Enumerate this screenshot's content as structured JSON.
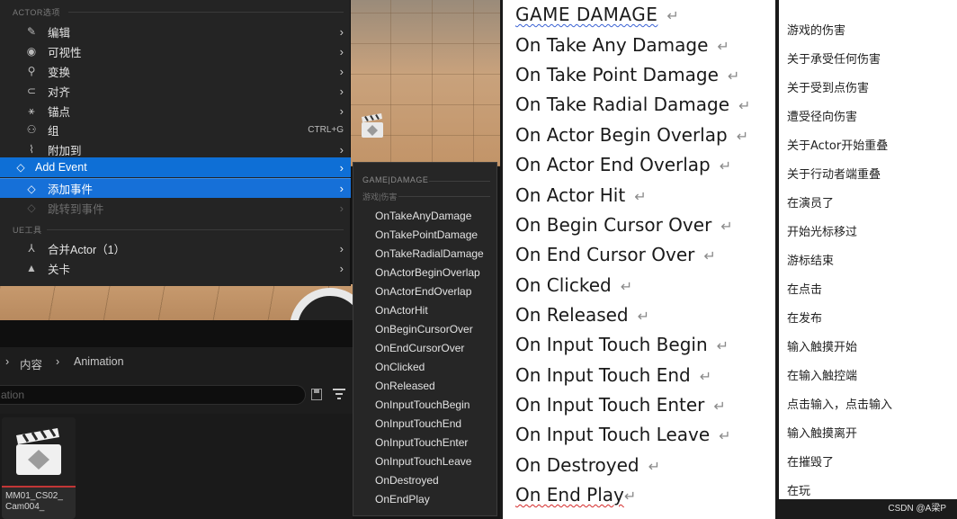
{
  "ue": {
    "actor_section_header": "ACTOR选项",
    "menu_items": [
      {
        "label": "编辑",
        "icon": "pencil-icon",
        "has_submenu": true
      },
      {
        "label": "可视性",
        "icon": "eye-icon",
        "has_submenu": true
      },
      {
        "label": "变换",
        "icon": "transform-icon",
        "has_submenu": true
      },
      {
        "label": "对齐",
        "icon": "magnet-icon",
        "has_submenu": true
      },
      {
        "label": "锚点",
        "icon": "pivot-icon",
        "has_submenu": true
      },
      {
        "label": "组",
        "icon": "group-icon",
        "shortcut": "CTRL+G"
      },
      {
        "label": "附加到",
        "icon": "attach-icon",
        "has_submenu": true
      },
      {
        "label": "Add Event",
        "icon": "event-icon",
        "has_submenu": true,
        "state": "highlighted"
      },
      {
        "label": "添加事件",
        "icon": "event-icon",
        "has_submenu": true,
        "state": "highlighted"
      },
      {
        "label": "跳转到事件",
        "icon": "jump-icon",
        "has_submenu": true,
        "state": "disabled"
      }
    ],
    "ue_tools_header": "UE工具",
    "tools_items": [
      {
        "label": "合并Actor（1）",
        "icon": "merge-icon",
        "has_submenu": true
      },
      {
        "label": "关卡",
        "icon": "level-icon",
        "has_submenu": true
      }
    ],
    "submenu": {
      "header": "GAME|DAMAGE",
      "subheader": "游戏|伤害",
      "items": [
        "OnTakeAnyDamage",
        "OnTakePointDamage",
        "OnTakeRadialDamage",
        "OnActorBeginOverlap",
        "OnActorEndOverlap",
        "OnActorHit",
        "OnBeginCursorOver",
        "OnEndCursorOver",
        "OnClicked",
        "OnReleased",
        "OnInputTouchBegin",
        "OnInputTouchEnd",
        "OnInputTouchEnter",
        "OnInputTouchLeave",
        "OnDestroyed",
        "OnEndPlay"
      ]
    },
    "breadcrumb": {
      "part1": "内容",
      "part2": "Animation"
    },
    "search_text": "ation",
    "asset_name": "MM01_CS02_\nCam004_",
    "accent_color": "#0e6fd6"
  },
  "en_list": {
    "title": "GAME   DAMAGE",
    "items": [
      "On Take Any Damage",
      "On Take Point Damage",
      "On Take Radial Damage",
      "On Actor Begin Overlap",
      "On Actor End Overlap",
      "On Actor Hit",
      "On Begin Cursor Over",
      "On End Cursor Over",
      "On Clicked",
      "On Released",
      "On Input Touch Begin",
      "On Input Touch End",
      "On Input Touch Enter",
      "On Input Touch Leave",
      "On Destroyed",
      "On End Play"
    ],
    "return_glyph": "↵"
  },
  "cn_list": {
    "items": [
      "游戏的伤害",
      "关于承受任何伤害",
      "关于受到点伤害",
      "遭受径向伤害",
      "关于Actor开始重叠",
      "关于行动者端重叠",
      "在演员了",
      "开始光标移过",
      "游标结束",
      "在点击",
      "在发布",
      "输入触摸开始",
      "在输入触控端",
      "点击输入，点击输入",
      "输入触摸离开",
      "在摧毁了",
      "在玩"
    ],
    "watermark": "CSDN @A梁P"
  }
}
